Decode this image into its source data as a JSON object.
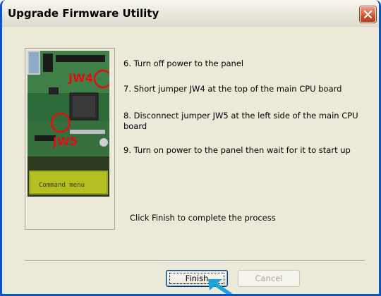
{
  "window": {
    "title": "Upgrade Firmware Utility"
  },
  "image": {
    "overlay_labels": [
      "JW4",
      "JW5"
    ],
    "lcd_text": "Command menu"
  },
  "steps": [
    {
      "text": "6. Turn off power to the panel"
    },
    {
      "text": "7. Short jumper JW4 at the top of the main CPU board"
    },
    {
      "text": "8. Disconnect jumper JW5 at the left side of the main CPU board"
    },
    {
      "text": "9. Turn on power to the panel then wait for it to start up"
    }
  ],
  "instruction": "Click Finish to complete the process",
  "buttons": {
    "finish": "Finish",
    "cancel": "Cancel"
  },
  "colors": {
    "title_bar_border": "#0a53d1",
    "close_button": "#d0532f",
    "dialog_bg": "#ece9d8",
    "pointer": "#1fa2d8"
  }
}
